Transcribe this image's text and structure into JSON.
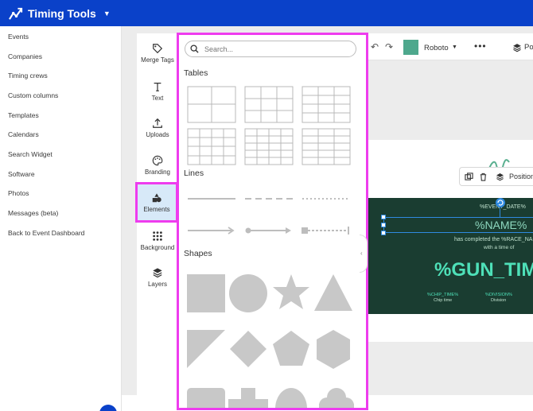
{
  "header": {
    "brand_name": "Timing Tools",
    "brand_color": "#0a41c9"
  },
  "nav": {
    "items": [
      "Events",
      "Companies",
      "Timing crews",
      "Custom columns",
      "Templates",
      "Calendars",
      "Search Widget",
      "Software",
      "Photos",
      "Messages (beta)",
      "Back to Event Dashboard"
    ]
  },
  "tools": {
    "items": [
      {
        "label": "Merge Tags",
        "icon": "tag-icon"
      },
      {
        "label": "Text",
        "icon": "text-icon"
      },
      {
        "label": "Uploads",
        "icon": "upload-icon"
      },
      {
        "label": "Branding",
        "icon": "palette-icon"
      },
      {
        "label": "Elements",
        "icon": "shapes-icon",
        "active": true
      },
      {
        "label": "Background",
        "icon": "grid-dots-icon"
      },
      {
        "label": "Layers",
        "icon": "layers-icon"
      }
    ]
  },
  "panel": {
    "search_placeholder": "Search...",
    "tables_title": "Tables",
    "lines_title": "Lines",
    "shapes_title": "Shapes",
    "highlight_color": "#ee3cee"
  },
  "canvas": {
    "font_name": "Roboto",
    "swatch_color": "#4ea88d",
    "position_button_cut": "Po",
    "context_position_label": "Position",
    "cert": {
      "event_date": "%EVENT_DATE%",
      "name": "%NAME%",
      "completed_line": "has completed the %RACE_NA",
      "time_of": "with a time of",
      "gun_time": "%GUN_TIM",
      "chip_time_tag": "%CHIP_TIME%",
      "chip_time_label": "Chip time",
      "division_tag": "%DIVISION%",
      "division_label": "Division"
    }
  }
}
